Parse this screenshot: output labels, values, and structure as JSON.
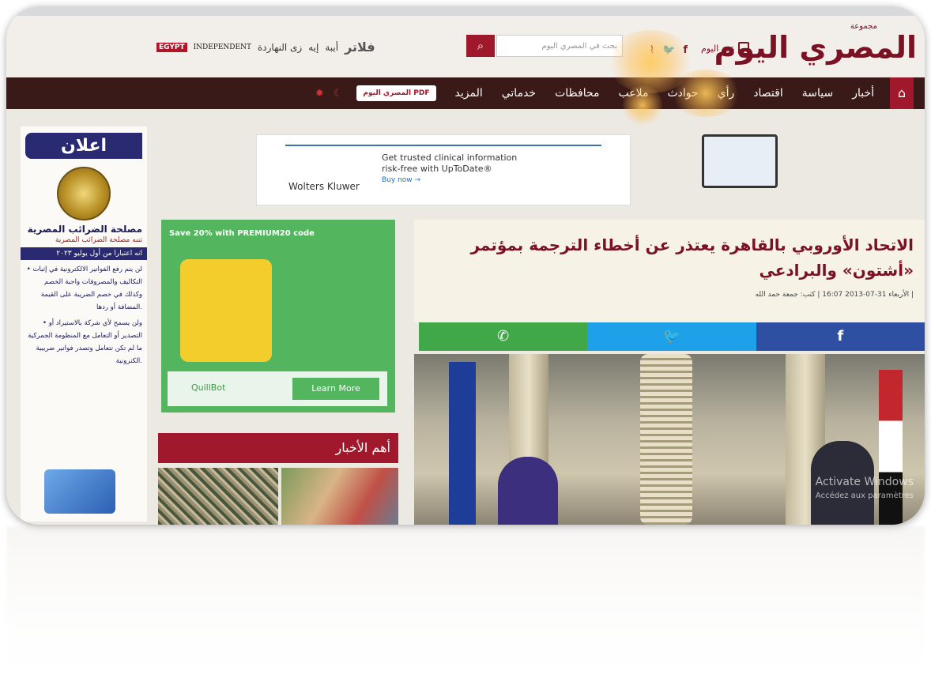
{
  "header": {
    "logo_text": "المصري اليوم",
    "logo_sub": "مجموعة",
    "edition_label": "عدد اليوم",
    "social_icons": [
      "rss-icon",
      "twitter-icon",
      "facebook-icon"
    ],
    "search_placeholder": "بحث في المصري اليوم",
    "search_icon": "search-icon",
    "brand_links": [
      "فلاتر",
      "أيبة",
      "إيه",
      "زى النهاردة"
    ],
    "independent_egypt": "EGYPT",
    "independent_label": "INDEPENDENT"
  },
  "nav": {
    "home_icon": "home-icon",
    "items": [
      "أخبار",
      "سياسة",
      "اقتصاد",
      "رأي",
      "حوادث",
      "ملاعب",
      "محافظات",
      "خدماتي",
      "المزيد"
    ],
    "pdf_label": "المصري اليوم PDF"
  },
  "sidebar": {
    "ad_heading": "اعلان",
    "title": "مصلحة الضرائب المصرية",
    "subtitle": "تنبه مصلحة الضرائب المصرية",
    "date_note": "انه اعتبارا من أول يوليو ٢٠٢٣",
    "text1": "• لن يتم رفع الفواتير الالكترونية في إثبات التكاليف والمصروفات واجبة الخصم وكذلك في خصم الضريبة على القيمة المضافة أو ردها.",
    "text2": "• ولن يسمح لأي شركة بالاستيراد أو التصدير أو التعامل مع المنظومة الجمركية ما لم تكن تتعامل وتصدر فواتير ضريبية الكترونية."
  },
  "top_ad": {
    "brand": "Wolters Kluwer",
    "line1": "Get trusted clinical information",
    "line2": "risk-free with UpToDate®",
    "cta": "Buy now →"
  },
  "left_ad": {
    "headline": "Save 20% with PREMIUM20 code",
    "brand": "QuillBot",
    "cta": "Learn More"
  },
  "news_section": {
    "title": "أهم الأخبار"
  },
  "article": {
    "headline": "الاتحاد الأوروبي بالقاهرة يعتذر عن أخطاء الترجمة بمؤتمر «أشتون» والبرادعي",
    "byline": "الأربعاء 31-07-2013 16:07 | كتب: جمعة حمد الله |",
    "share": [
      "facebook",
      "twitter",
      "whatsapp"
    ],
    "share_colors": {
      "facebook": "#2f4fa3",
      "twitter": "#1ea1e8",
      "whatsapp": "#41a84a"
    }
  },
  "overlay": {
    "line1": "Activate Windows",
    "line2": "Accédez aux paramètres"
  },
  "colors": {
    "brand": "#a0182c",
    "nav_bg": "#3a1a19",
    "logo": "#7a1224"
  }
}
